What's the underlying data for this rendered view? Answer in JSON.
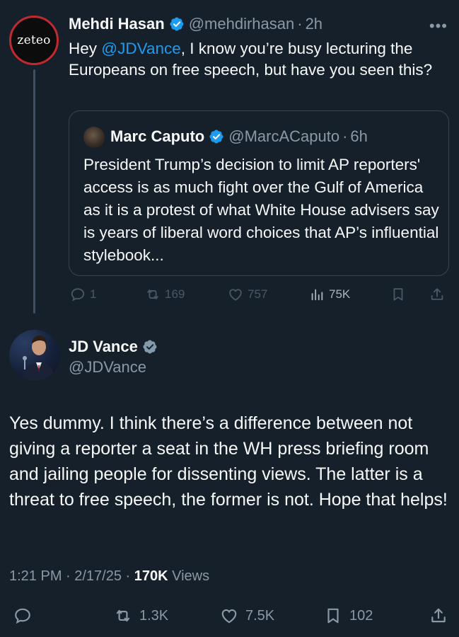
{
  "colors": {
    "background": "#15202b",
    "text": "#f7f9f9",
    "secondary": "#8b98a5",
    "link": "#1d9bf0",
    "verified_blue": "#1d9bf0",
    "verified_gray": "#829aab",
    "zeteo_ring": "#c02a2f"
  },
  "tweet": {
    "avatar_text": "zeteo",
    "name": "Mehdi Hasan",
    "handle": "@mehdirhasan",
    "separator": "·",
    "time": "2h",
    "more_icon": "more-horizontal-icon",
    "text_before_mention": "Hey ",
    "mention": "@JDVance",
    "text_after_mention": ", I know you’re busy lecturing the Europeans on free speech, but have you seen this?",
    "quote": {
      "name": "Marc Caputo",
      "handle": "@MarcACaputo",
      "separator": "·",
      "time": "6h",
      "text": "President Trump’s decision to limit AP reporters' access is as much fight over the Gulf of America as it is a protest of what White House advisers say is years of liberal word choices that AP’s influential stylebook..."
    },
    "actions": {
      "replies": "1",
      "retweets": "169",
      "likes": "757",
      "views": "75K"
    }
  },
  "reply": {
    "name": "JD Vance",
    "handle": "@JDVance",
    "text": "Yes dummy. I think there’s a difference between not giving a reporter a seat in the WH press briefing room and jailing people for dissenting views. The latter is a threat to free speech, the former is not. Hope that helps!",
    "timestamp": "1:21 PM · 2/17/25 · ",
    "views_count": "170K",
    "views_label": " Views",
    "actions": {
      "retweets": "1.3K",
      "likes": "7.5K",
      "bookmarks": "102"
    }
  }
}
